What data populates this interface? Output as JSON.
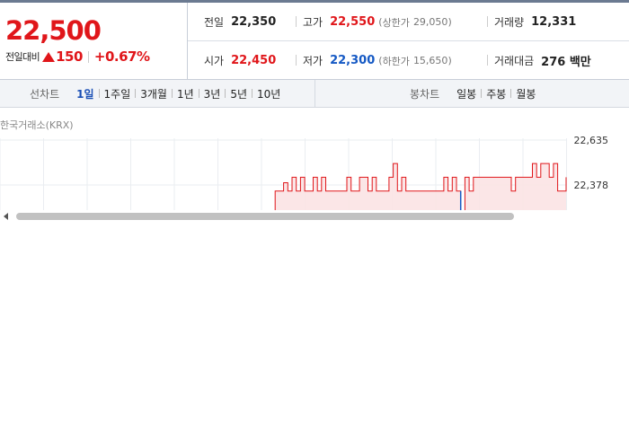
{
  "summary": {
    "current_price": "22,500",
    "change_label": "전일대비",
    "change_amount": "150",
    "change_rate": "+0.67%",
    "prev_close": {
      "label": "전일",
      "value": "22,350"
    },
    "high": {
      "label": "고가",
      "value": "22,550",
      "limit_label": "상한가",
      "limit_value": "29,050"
    },
    "volume": {
      "label": "거래량",
      "value": "12,331"
    },
    "open": {
      "label": "시가",
      "value": "22,450"
    },
    "low": {
      "label": "저가",
      "value": "22,300",
      "limit_label": "하한가",
      "limit_value": "15,650"
    },
    "trade_value": {
      "label": "거래대금",
      "value": "276 백만"
    },
    "colors": {
      "up": "#e0161a",
      "down": "#1559c4"
    }
  },
  "tabs": {
    "line_chart_title": "선차트",
    "line_periods": [
      "1일",
      "1주일",
      "3개월",
      "1년",
      "3년",
      "5년",
      "10년"
    ],
    "active_period": "1일",
    "candle_chart_title": "봉차트",
    "candle_periods": [
      "일봉",
      "주봉",
      "월봉"
    ]
  },
  "chart": {
    "market_label": "한국거래소(KRX)",
    "y_top_label": "22,635",
    "y_ref_label": "22,378",
    "line_color": "#e0161a",
    "fill_color": "#fbe3e4",
    "down_tick_color": "#1559c4"
  },
  "chart_data": {
    "type": "line",
    "title": "",
    "ylim": [
      22250,
      22635
    ],
    "reference_price": 22378,
    "series": [
      {
        "values": [
          22300,
          22300,
          22310,
          22320,
          22340,
          22320,
          22350,
          22310,
          22330,
          22450,
          22450,
          22480,
          22450,
          22500,
          22450,
          22500,
          22450,
          22450,
          22500,
          22450,
          22500,
          22450,
          22450,
          22450,
          22450,
          22450,
          22500,
          22450,
          22450,
          22500,
          22500,
          22450,
          22500,
          22450,
          22450,
          22450,
          22500,
          22550,
          22450,
          22500,
          22450,
          22450,
          22450,
          22450,
          22450,
          22450,
          22450,
          22450,
          22450,
          22500,
          22450,
          22500,
          22450,
          22300,
          22500,
          22450,
          22500,
          22500,
          22500,
          22500,
          22500,
          22500,
          22500,
          22500,
          22500,
          22450,
          22500,
          22500,
          22500,
          22500,
          22550,
          22500,
          22550,
          22550,
          22500,
          22550,
          22450,
          22450,
          22500
        ]
      }
    ],
    "grid": true
  },
  "scrollbar": {
    "visible": true
  }
}
